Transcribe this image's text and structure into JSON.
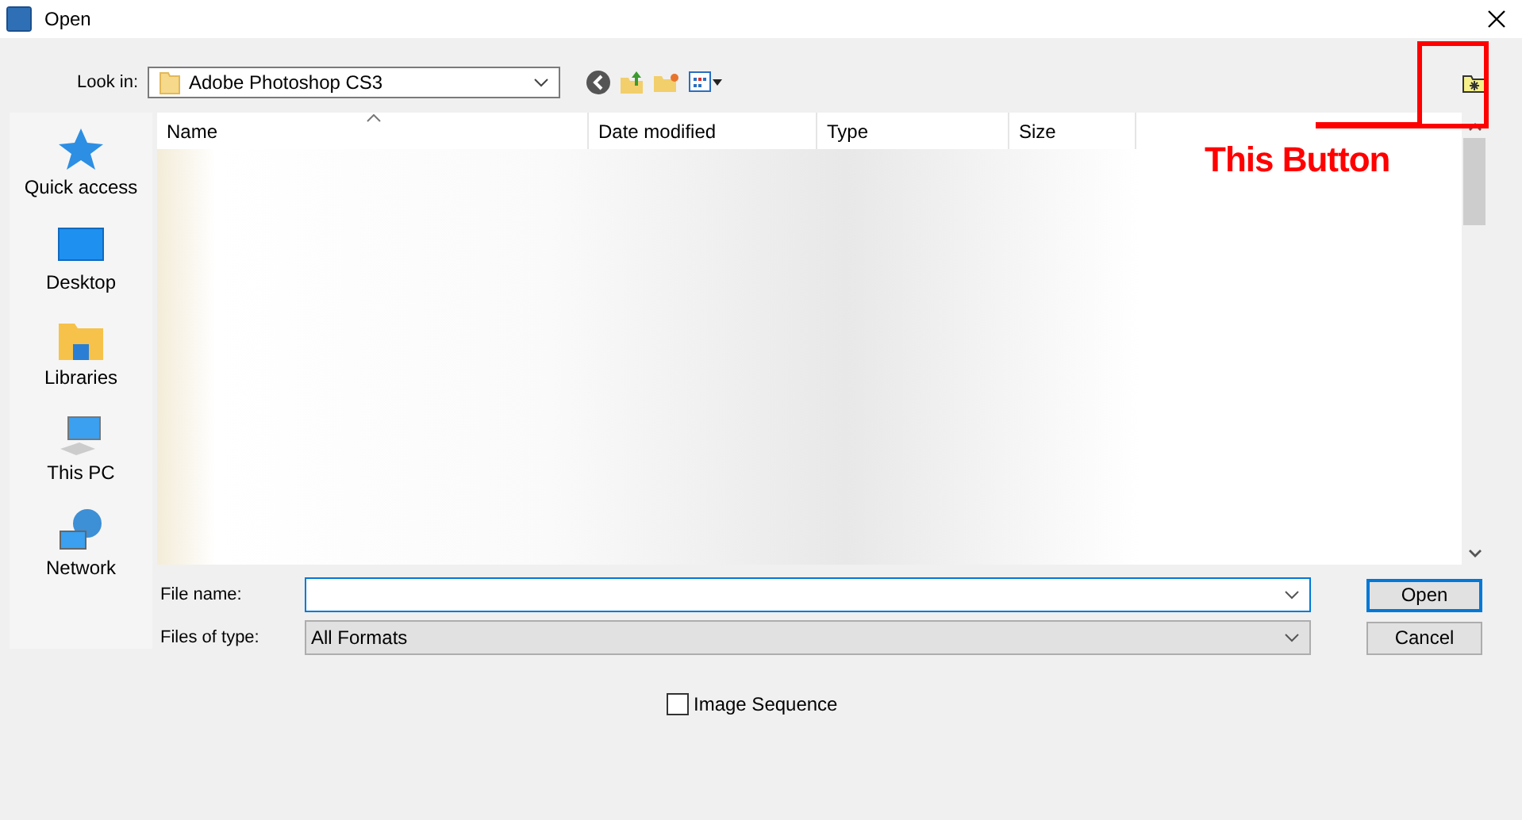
{
  "window": {
    "title": "Open"
  },
  "look_in": {
    "label": "Look in:",
    "value": "Adobe Photoshop CS3"
  },
  "sidebar": {
    "items": [
      {
        "label": "Quick access",
        "kind": "star"
      },
      {
        "label": "Desktop",
        "kind": "desktop"
      },
      {
        "label": "Libraries",
        "kind": "libraries"
      },
      {
        "label": "This PC",
        "kind": "pc"
      },
      {
        "label": "Network",
        "kind": "network"
      }
    ]
  },
  "table": {
    "columns": [
      "Name",
      "Date modified",
      "Type",
      "Size"
    ]
  },
  "file_name": {
    "label": "File name:"
  },
  "file_type": {
    "label": "Files of type:",
    "value": "All Formats"
  },
  "buttons": [
    "Open",
    "Cancel"
  ],
  "image_sequence": {
    "label": "Image Sequence",
    "checked": false
  },
  "annotation": {
    "text": "This Button"
  }
}
